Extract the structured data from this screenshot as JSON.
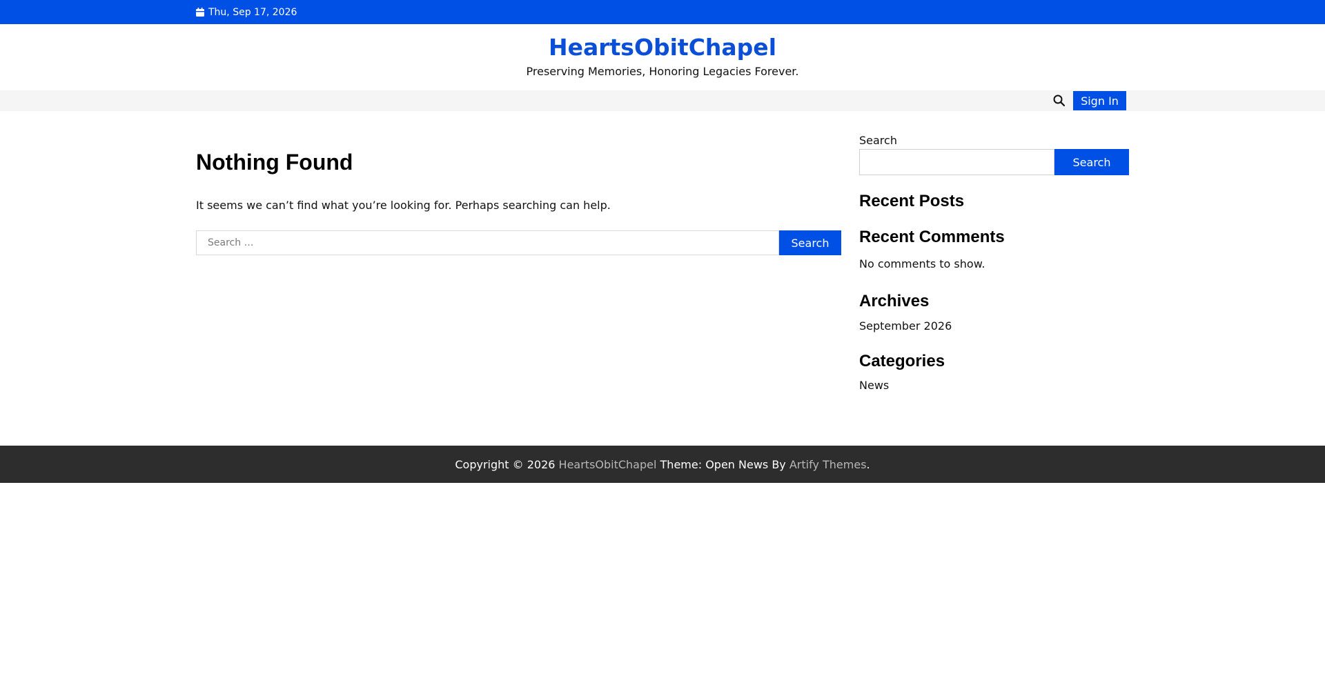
{
  "topbar": {
    "date": "Thu, Sep 17, 2026",
    "icon": "calendar-icon"
  },
  "branding": {
    "title": "HeartsObitChapel",
    "tagline": "Preserving Memories, Honoring Legacies Forever."
  },
  "nav": {
    "search_icon": "search-icon",
    "signin_label": "Sign In"
  },
  "main": {
    "heading": "Nothing Found",
    "message": "It seems we can’t find what you’re looking for. Perhaps searching can help.",
    "search": {
      "placeholder": "Search …",
      "value": "",
      "button_label": "Search"
    }
  },
  "sidebar": {
    "search": {
      "label": "Search",
      "value": "",
      "button_label": "Search"
    },
    "recent_posts": {
      "heading": "Recent Posts"
    },
    "recent_comments": {
      "heading": "Recent Comments",
      "empty_text": "No comments to show."
    },
    "archives": {
      "heading": "Archives",
      "items": [
        "September 2026"
      ]
    },
    "categories": {
      "heading": "Categories",
      "items": [
        "News"
      ]
    }
  },
  "footer": {
    "copyright": "Copyright © 2026 ",
    "site_link": "HeartsObitChapel",
    "theme_text": " Theme: Open News By ",
    "theme_link": "Artify Themes",
    "end": "."
  },
  "colors": {
    "accent": "#0050e6",
    "title_blue": "#0b4fd6",
    "footer_bg": "#2d2d2d",
    "nav_bg": "#f5f5f5"
  }
}
